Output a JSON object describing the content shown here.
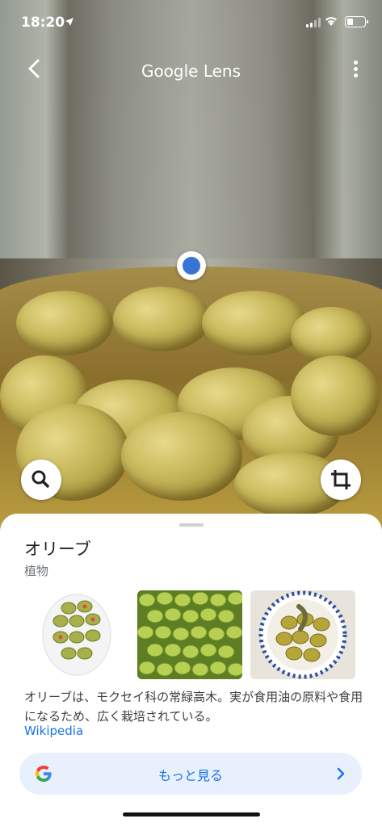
{
  "status_bar": {
    "time": "18:20"
  },
  "header": {
    "title": "Google Lens"
  },
  "result": {
    "title": "オリーブ",
    "category": "植物",
    "description": "オリーブは、モクセイ科の常緑高木。実が食用油の原料や食用になるため、広く栽培されている。",
    "source_link": "Wikipedia",
    "more_button": "もっと見る"
  },
  "icons": [
    "back-arrow-icon",
    "more-vert-icon",
    "search-icon",
    "crop-icon",
    "google-g-icon",
    "chevron-right-icon",
    "location-arrow-icon",
    "signal-icon",
    "wifi-icon",
    "battery-icon"
  ],
  "colors": {
    "accent": "#1a73e8",
    "dot": "#3a73d6",
    "button_bg": "#e8f0fe"
  }
}
